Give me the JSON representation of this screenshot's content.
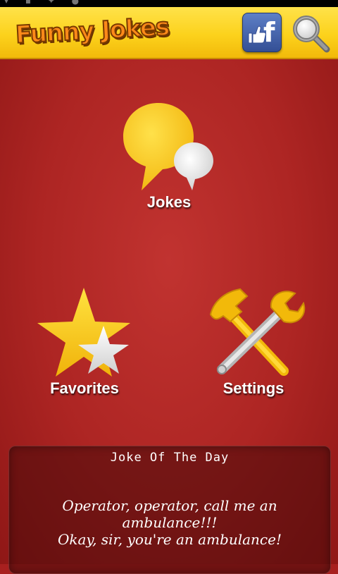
{
  "app": {
    "title": "Funny Jokes"
  },
  "header": {
    "facebook_icon": "facebook-like-icon",
    "search_icon": "magnifier-icon"
  },
  "menu": {
    "jokes": {
      "label": "Jokes",
      "icon": "speech-bubbles-icon"
    },
    "favorites": {
      "label": "Favorites",
      "icon": "stars-icon"
    },
    "settings": {
      "label": "Settings",
      "icon": "hammer-wrench-icon"
    }
  },
  "joke_of_the_day": {
    "title": "Joke Of The Day",
    "line1": "Operator, operator, call me an ambulance!!!",
    "line2": "Okay, sir, you're an ambulance!"
  },
  "colors": {
    "background": "#a8201f",
    "topbar": "#fcd21c",
    "accent_orange": "#ff8a1a",
    "icon_yellow": "#f7c81b"
  }
}
